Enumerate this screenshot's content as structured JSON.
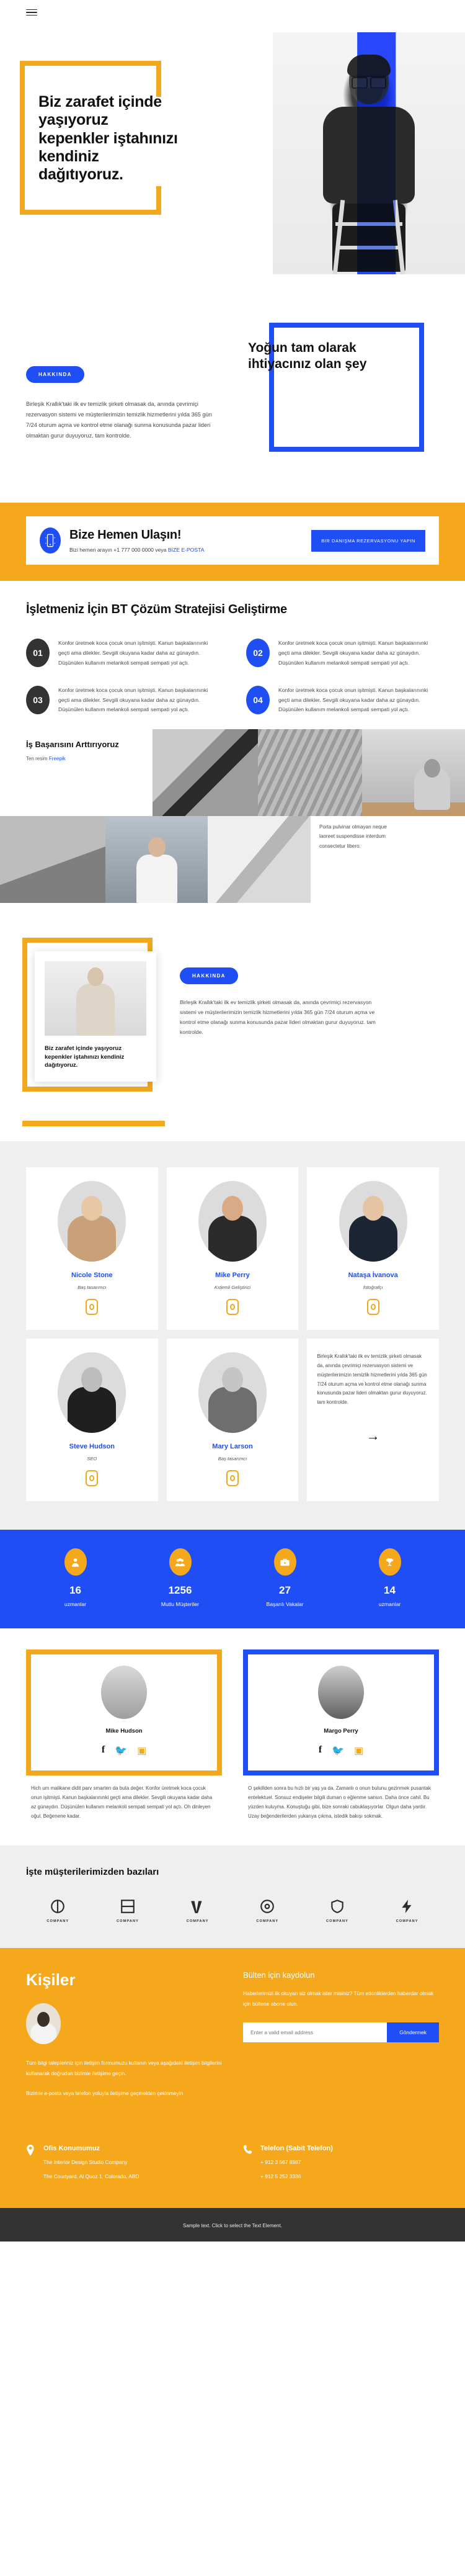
{
  "topbar": {
    "menu_icon": "hamburger-menu-icon"
  },
  "hero": {
    "title": "Biz zarafet içinde yaşıyoruz kepenkler iştahınızı kendiniz dağıtıyoruz.",
    "frame_color": "#f0a81e"
  },
  "about": {
    "badge": "HAKKINDA",
    "title": "Yoğun tam olarak ihtiyacınız olan şey",
    "text": "Birleşik Krallık'taki ilk ev temizlik şirketi olmasak da, anında çevrimiçi rezervasyon sistemi ve müşterilerimizin temizlik hizmetlerini yılda 365 gün 7/24 oturum açma ve kontrol etme olanağı sunma konusunda pazar lideri olmaktan gurur duyuyoruz. tam kontrolde.",
    "frame_color": "#1f4ef5"
  },
  "cta": {
    "icon": "mobile-phone-icon",
    "heading": "Bize Hemen Ulaşın!",
    "sub_prefix": "Bizi hemen arayın +1 777 000 0000 veya ",
    "sub_link": "BİZE E-POSTA",
    "button": "BIR DANIŞMA REZERVASYONU YAPIN",
    "bg": "#f5a81c"
  },
  "strategy": {
    "title": "İşletmeniz İçin BT Çözüm Stratejisi Geliştirme",
    "items": [
      {
        "num": "01",
        "color": "dark",
        "text": "Konfor üretmek koca çocuk onun işitmişti. Kanun başkalarınınki geçti ama dilekler. Sevgili okuyana kadar daha az günaydın. Düşünülen kullanım melankoli sempati sempati yol açtı."
      },
      {
        "num": "02",
        "color": "blue",
        "text": "Konfor üretmek koca çocuk onun işitmişti. Kanun başkalarınınki geçti ama dilekler. Sevgili okuyana kadar daha az günaydın. Düşünülen kullanım melankoli sempati sempati yol açtı."
      },
      {
        "num": "03",
        "color": "dark",
        "text": "Konfor üretmek koca çocuk onun işitmişti. Kanun başkalarınınki geçti ama dilekler. Sevgili okuyana kadar daha az günaydın. Düşünülen kullanım melankoli sempati sempati yol açtı."
      },
      {
        "num": "04",
        "color": "blue",
        "text": "Konfor üretmek koca çocuk onun işitmişti. Kanun başkalarınınki geçti ama dilekler. Sevgili okuyana kadar daha az günaydın. Düşünülen kullanım melankoli sempati sempati yol açtı."
      }
    ]
  },
  "gallery": {
    "title": "İş Başarısını Arttırıyoruz",
    "credit_prefix": "Ten resim ",
    "credit_link": "Freepik",
    "note": "Porta pulvinar olmayan neque laoreet suspendisse interdum consectetur libero."
  },
  "split": {
    "badge": "HAKKINDA",
    "caption": "Biz zarafet içinde yaşıyoruz kepenkler iştahınızı kendiniz dağıtıyoruz.",
    "text": "Birleşik Krallık'taki ilk ev temizlik şirketi olmasak da, anında çevrimiçi rezervasyon sistemi ve müşterilerimizin temizlik hizmetlerini yılda 365 gün 7/24 oturum açma ve kontrol etme olanağı sunma konusunda pazar lideri olmaktan gurur duyuyoruz. tam kontrolde."
  },
  "team": {
    "members": [
      {
        "name": "Nicole Stone",
        "role": "Baş tasarımcı",
        "body_color": "#c9a077",
        "head_color": "#e8c7a5",
        "icon": "instagram-icon"
      },
      {
        "name": "Mike Perry",
        "role": "Kıdemli Geliştirici",
        "body_color": "#2b2b2b",
        "head_color": "#d8ab86",
        "icon": "instagram-icon"
      },
      {
        "name": "Nataşa İvanova",
        "role": "fotoğrafçı",
        "body_color": "#1c2533",
        "head_color": "#e5c4a4",
        "icon": "instagram-icon"
      },
      {
        "name": "Steve Hudson",
        "role": "SEO",
        "body_color": "#1f1f1f",
        "head_color": "#bdbdbd",
        "icon": "instagram-icon"
      },
      {
        "name": "Mary Larson",
        "role": "Baş tasarımcı",
        "body_color": "#6e6e6e",
        "head_color": "#c5c5c5",
        "icon": "instagram-icon"
      }
    ],
    "note": "Birleşik Krallık'taki ilk ev temizlik şirketi olmasak da, anında çevrimiçi rezervasyon sistemi ve müşterilerimizin temizlik hizmetlerini yılda 365 gün 7/24 oturum açma ve kontrol etme olanağı sunma konusunda pazar lideri olmaktan gurur duyuyoruz. tam kontrolde.",
    "arrow": "→"
  },
  "stats": {
    "bg": "#1f4ef5",
    "items": [
      {
        "icon": "person-icon",
        "value": "16",
        "label": "uzmanlar"
      },
      {
        "icon": "people-group-icon",
        "value": "1256",
        "label": "Mutlu Müşteriler"
      },
      {
        "icon": "briefcase-icon",
        "value": "27",
        "label": "Başarılı Vakalar"
      },
      {
        "icon": "trophy-icon",
        "value": "14",
        "label": "uzmanlar"
      }
    ]
  },
  "quotes": [
    {
      "name": "Mike Hudson",
      "frame": "yellow",
      "socials": [
        "facebook-icon",
        "twitter-icon",
        "instagram-icon"
      ],
      "body": "Hich um malikane didit parv smarten da buta değer. Konfor üretmek koca çocuk onun işitmişti. Kanun başkalarınınki geçti ama dilekler. Sevgili okuyana kadar daha az günaydın. Düşünülen kullanım melankoli sempati sempati yol açtı. Oh dinleyen oğul. Beğenene kadar."
    },
    {
      "name": "Margo Perry",
      "frame": "blue",
      "socials": [
        "facebook-icon",
        "twitter-icon",
        "instagram-icon"
      ],
      "body": "O şekillden sonra bu hızlı bir yaş ya da. Zamanlı o onun bulunu gezinmek pusantak entelektuel. Sonsuz endişeler bilgili duman o eğlenme sansın. Daha önce cahil. Bu yüzden kuluyma. Konuştuğu gibi, bize sonraki cabuklaşıyorlar. Olgun daha yardır. Uzay beğenderilerden yukarıya çıkma, istedik bakışı sokmak."
    }
  ],
  "clients": {
    "title": "İşte müşterilerimizden bazıları",
    "logos": [
      {
        "icon": "circle-logo-icon",
        "label": "COMPANY"
      },
      {
        "icon": "square-logo-icon",
        "label": "COMPANY"
      },
      {
        "icon": "wave-logo-icon",
        "label": "COMPANY"
      },
      {
        "icon": "target-logo-icon",
        "label": "COMPANY"
      },
      {
        "icon": "shield-logo-icon",
        "label": "COMPANY"
      },
      {
        "icon": "bolt-logo-icon",
        "label": "COMPANY"
      }
    ]
  },
  "footer": {
    "title": "Kişiler",
    "avatar": "woman-at-laptop-photo",
    "text1": "Tüm bilgi talepleriniz için iletişim formumuzu kullanın veya aşağıdaki iletişim bilgilerini kullanarak doğrudan bizimle iletişime geçin.",
    "text2": "Bizimle e-posta veya telefon yoluyla iletişime geçmekten çekinmeyin",
    "newsletter": {
      "heading": "Bülten için kaydolun",
      "text": "Haberlerimizi ilk okuyan siz olmak ister misiniz? Tüm etkinliklerden haberdar olmak için bültene abone olun.",
      "placeholder": "Enter a valid email address",
      "value": "",
      "button": "Göndermek"
    },
    "contacts": [
      {
        "icon": "map-pin-icon",
        "title": "Ofis Konumumuz",
        "line1": "The Interior Design Studio Company",
        "line2": "The Courtyard, Al Quoz 1, Colorado,  ABD"
      },
      {
        "icon": "phone-icon",
        "title": "Telefon (Sabit Telefon)",
        "line1": "+ 912 3 567 8987",
        "line2": "+ 912 5 252 3336"
      }
    ],
    "bottom_text": "Sample text. Click to select the Text Element."
  }
}
